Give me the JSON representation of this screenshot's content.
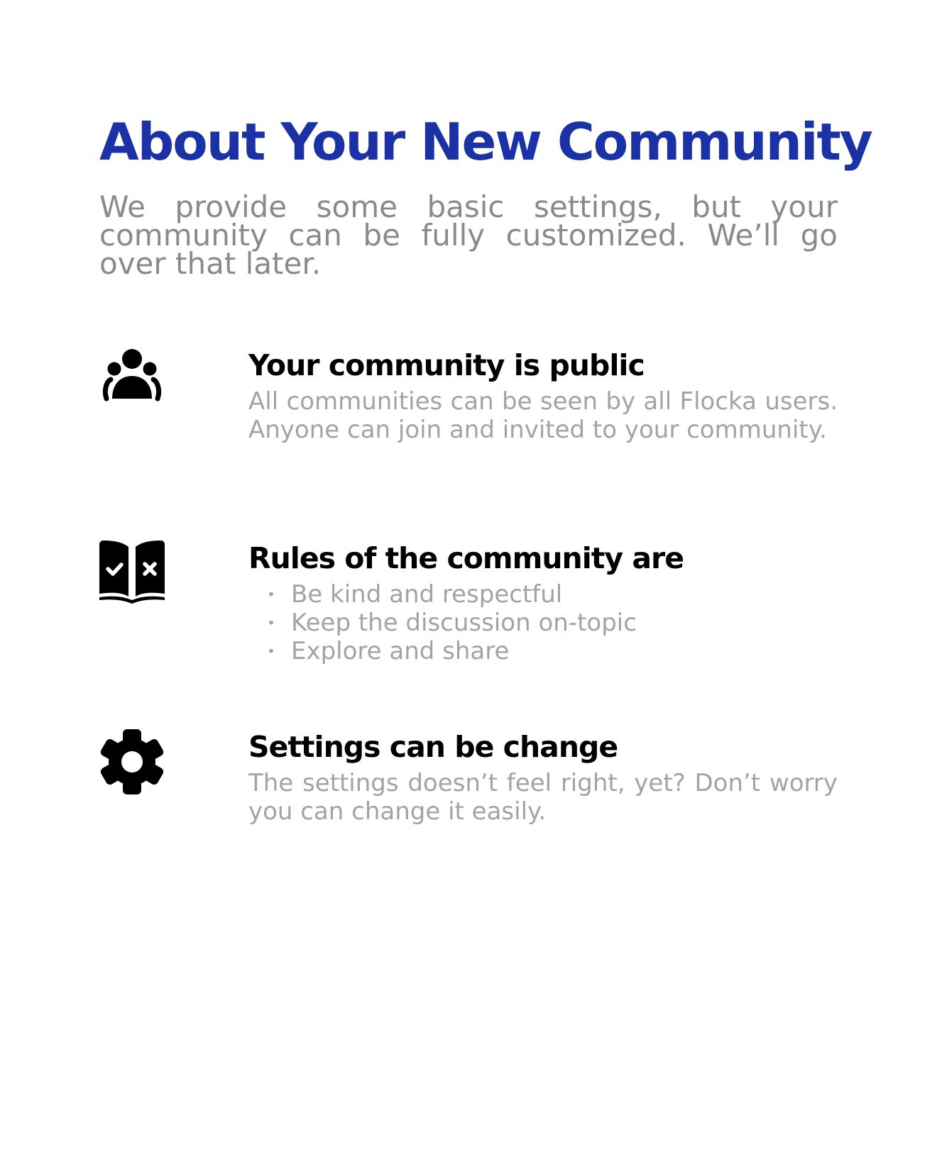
{
  "page": {
    "title": "About Your New Community",
    "intro": "We provide some basic settings, but your community can be fully customized. We’ll go over that later."
  },
  "features": {
    "public": {
      "icon": "group-icon",
      "heading": "Your community is public",
      "text": "All communities can be seen by all Flocka users. Anyone can join and invited to your community."
    },
    "rules": {
      "icon": "rule-book-icon",
      "heading": "Rules of the community are",
      "bullet": "•",
      "items": [
        "Be kind and respectful",
        "Keep the discussion on-topic",
        "Explore and share"
      ]
    },
    "settings": {
      "icon": "gear-icon",
      "heading": "Settings can be change",
      "text": "The settings doesn’t feel right, yet? Don’t worry you can change it easily."
    }
  },
  "colors": {
    "title": "#1b32a6",
    "heading": "#000000",
    "intro_text": "#8a8a8a",
    "body_text": "#a3a3a3",
    "icon": "#000000"
  }
}
